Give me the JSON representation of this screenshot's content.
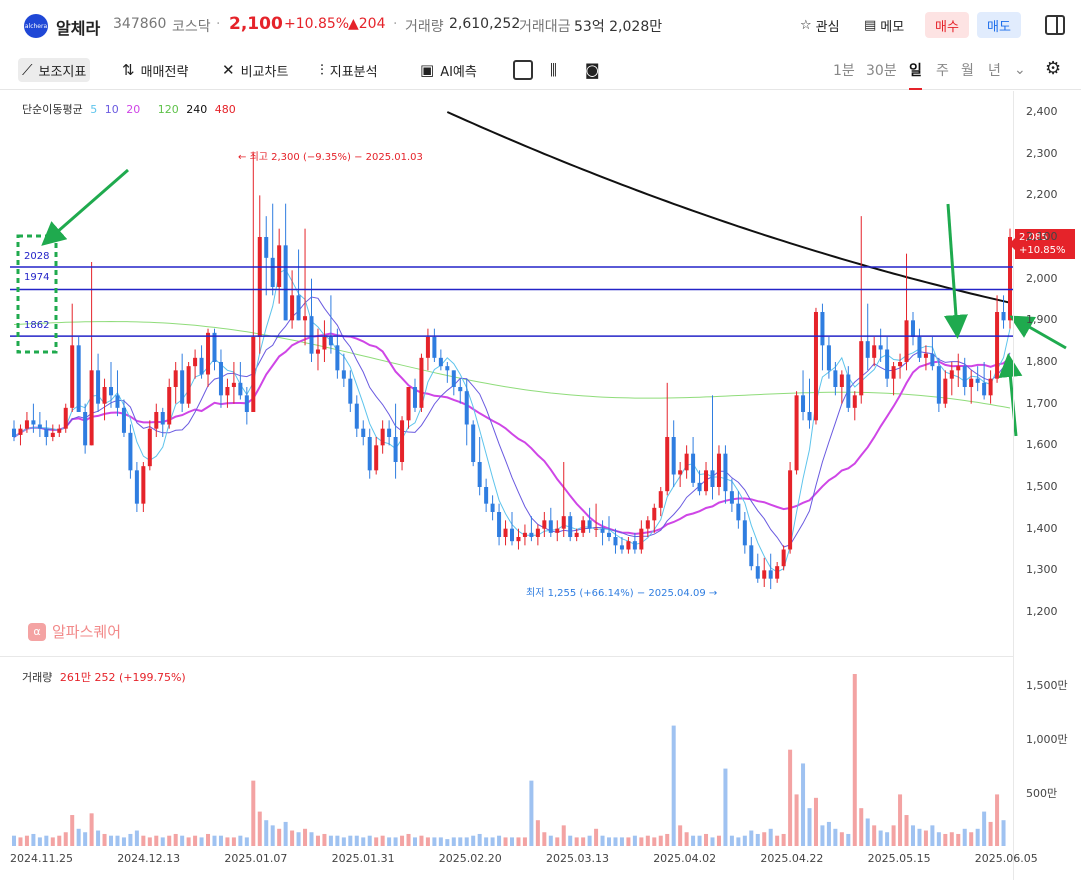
{
  "header": {
    "logo_text": "alchera",
    "name": "알체라",
    "code": "347860",
    "market": "코스닥",
    "separator": "·",
    "price": "2,100",
    "change_pct": "+10.85%",
    "change_amt": "▲204",
    "volume_label": "거래량",
    "volume_value": "2,610,252",
    "amount_label": "거래대금",
    "amount_value": "53억 2,028만",
    "fav_label": "관심",
    "memo_label": "메모",
    "buy_label": "매수",
    "sell_label": "매도"
  },
  "toolbar": {
    "indicators_label": "보조지표",
    "strategy_label": "매매전략",
    "compare_label": "비교차트",
    "analysis_label": "지표분석",
    "ai_label": "AI예측",
    "periods": [
      "1분",
      "30분",
      "일",
      "주",
      "월",
      "년"
    ],
    "selected_period": "일"
  },
  "chart": {
    "ma_legend": {
      "label": "단순이동평균",
      "p5": "5",
      "p10": "10",
      "p20": "20",
      "p120": "120",
      "p240": "240",
      "p480": "480"
    },
    "colors": {
      "up": "#e5232a",
      "down": "#2f7de0",
      "ma5": "#5ec4ec",
      "ma10": "#6a5ae0",
      "ma20": "#cf46e6",
      "ma120": "#8fdc7a",
      "ma240": "#111111",
      "level": "#2424c8",
      "arrow": "#1faa4e"
    },
    "high_note": "최고 2,300 (−9.35%) − 2025.01.03",
    "low_note": "최저 1,255 (+66.14%) − 2025.04.09",
    "level_labels": [
      "2028",
      "1974",
      "1862"
    ],
    "levels": [
      2028,
      1974,
      1862
    ],
    "last_price": "2,085",
    "last_pct": "+10.85%",
    "watermark": "알파스퀘어",
    "watermark_icon": "α"
  },
  "volume": {
    "label": "거래량",
    "value": "261만 252 (+199.75%)"
  },
  "chart_data": {
    "type": "candlestick",
    "price_axis": {
      "ticks": [
        "2,400",
        "2,300",
        "2,200",
        "2,100",
        "2,000",
        "1,900",
        "1,800",
        "1,700",
        "1,600",
        "1,500",
        "1,400",
        "1,300",
        "1,200"
      ],
      "range": [
        1200,
        2400
      ]
    },
    "volume_axis": {
      "ticks": [
        "1,500만",
        "1,000만",
        "500만"
      ]
    },
    "x_ticks": [
      "2024.11.25",
      "2024.12.13",
      "2025.01.07",
      "2025.01.31",
      "2025.02.20",
      "2025.03.13",
      "2025.04.02",
      "2025.04.22",
      "2025.05.15",
      "2025.06.05"
    ],
    "candles": [
      [
        1640,
        1660,
        1610,
        1620
      ],
      [
        1625,
        1650,
        1600,
        1640
      ],
      [
        1640,
        1680,
        1630,
        1660
      ],
      [
        1660,
        1700,
        1630,
        1650
      ],
      [
        1650,
        1680,
        1620,
        1640
      ],
      [
        1640,
        1660,
        1600,
        1620
      ],
      [
        1620,
        1650,
        1610,
        1630
      ],
      [
        1630,
        1650,
        1620,
        1640
      ],
      [
        1640,
        1700,
        1630,
        1690
      ],
      [
        1690,
        1940,
        1680,
        1840
      ],
      [
        1840,
        1860,
        1700,
        1680
      ],
      [
        1680,
        1700,
        1580,
        1600
      ],
      [
        1600,
        2040,
        1600,
        1780
      ],
      [
        1780,
        1820,
        1680,
        1700
      ],
      [
        1700,
        1760,
        1660,
        1740
      ],
      [
        1740,
        1800,
        1690,
        1720
      ],
      [
        1720,
        1780,
        1670,
        1690
      ],
      [
        1690,
        1710,
        1620,
        1630
      ],
      [
        1630,
        1650,
        1520,
        1540
      ],
      [
        1540,
        1560,
        1440,
        1460
      ],
      [
        1460,
        1560,
        1440,
        1550
      ],
      [
        1550,
        1660,
        1540,
        1640
      ],
      [
        1640,
        1700,
        1620,
        1680
      ],
      [
        1680,
        1690,
        1620,
        1650
      ],
      [
        1650,
        1760,
        1640,
        1740
      ],
      [
        1740,
        1800,
        1700,
        1780
      ],
      [
        1780,
        1820,
        1680,
        1700
      ],
      [
        1700,
        1800,
        1690,
        1790
      ],
      [
        1790,
        1830,
        1760,
        1810
      ],
      [
        1810,
        1840,
        1760,
        1770
      ],
      [
        1770,
        1880,
        1740,
        1870
      ],
      [
        1870,
        1880,
        1780,
        1800
      ],
      [
        1800,
        1830,
        1690,
        1720
      ],
      [
        1720,
        1760,
        1690,
        1740
      ],
      [
        1740,
        1800,
        1700,
        1750
      ],
      [
        1750,
        1800,
        1710,
        1720
      ],
      [
        1720,
        1740,
        1650,
        1680
      ],
      [
        1680,
        2300,
        1690,
        1860
      ],
      [
        1860,
        2200,
        1820,
        2100
      ],
      [
        2100,
        2150,
        1960,
        2050
      ],
      [
        2050,
        2180,
        1960,
        1980
      ],
      [
        1980,
        2120,
        1940,
        2080
      ],
      [
        2080,
        2180,
        1900,
        1900
      ],
      [
        1900,
        2020,
        1880,
        1960
      ],
      [
        1960,
        2070,
        1900,
        1900
      ],
      [
        1900,
        2120,
        1840,
        1910
      ],
      [
        1910,
        2000,
        1800,
        1820
      ],
      [
        1820,
        1880,
        1780,
        1830
      ],
      [
        1830,
        1900,
        1800,
        1860
      ],
      [
        1860,
        1960,
        1820,
        1840
      ],
      [
        1840,
        1880,
        1760,
        1780
      ],
      [
        1780,
        1820,
        1740,
        1760
      ],
      [
        1760,
        1780,
        1680,
        1700
      ],
      [
        1700,
        1720,
        1620,
        1640
      ],
      [
        1640,
        1660,
        1600,
        1620
      ],
      [
        1620,
        1640,
        1520,
        1540
      ],
      [
        1540,
        1620,
        1530,
        1600
      ],
      [
        1600,
        1660,
        1580,
        1640
      ],
      [
        1640,
        1660,
        1600,
        1620
      ],
      [
        1620,
        1700,
        1520,
        1560
      ],
      [
        1560,
        1670,
        1540,
        1660
      ],
      [
        1660,
        1740,
        1640,
        1740
      ],
      [
        1740,
        1760,
        1680,
        1690
      ],
      [
        1690,
        1820,
        1680,
        1810
      ],
      [
        1810,
        1880,
        1780,
        1860
      ],
      [
        1860,
        1880,
        1800,
        1810
      ],
      [
        1810,
        1830,
        1780,
        1790
      ],
      [
        1790,
        1800,
        1750,
        1780
      ],
      [
        1780,
        1780,
        1720,
        1740
      ],
      [
        1740,
        1760,
        1700,
        1730
      ],
      [
        1730,
        1760,
        1600,
        1650
      ],
      [
        1650,
        1660,
        1550,
        1560
      ],
      [
        1560,
        1620,
        1480,
        1500
      ],
      [
        1500,
        1520,
        1440,
        1460
      ],
      [
        1460,
        1480,
        1420,
        1440
      ],
      [
        1440,
        1460,
        1360,
        1380
      ],
      [
        1380,
        1420,
        1360,
        1400
      ],
      [
        1400,
        1440,
        1360,
        1370
      ],
      [
        1370,
        1400,
        1350,
        1380
      ],
      [
        1380,
        1410,
        1360,
        1390
      ],
      [
        1390,
        1430,
        1370,
        1380
      ],
      [
        1380,
        1410,
        1360,
        1400
      ],
      [
        1400,
        1440,
        1380,
        1420
      ],
      [
        1420,
        1450,
        1380,
        1390
      ],
      [
        1390,
        1420,
        1370,
        1400
      ],
      [
        1400,
        1560,
        1380,
        1430
      ],
      [
        1430,
        1440,
        1370,
        1380
      ],
      [
        1380,
        1400,
        1370,
        1390
      ],
      [
        1390,
        1430,
        1380,
        1420
      ],
      [
        1420,
        1450,
        1390,
        1400
      ],
      [
        1400,
        1460,
        1380,
        1400
      ],
      [
        1400,
        1420,
        1360,
        1390
      ],
      [
        1390,
        1430,
        1370,
        1380
      ],
      [
        1380,
        1400,
        1340,
        1360
      ],
      [
        1360,
        1380,
        1340,
        1350
      ],
      [
        1350,
        1380,
        1340,
        1370
      ],
      [
        1370,
        1390,
        1340,
        1350
      ],
      [
        1350,
        1420,
        1340,
        1400
      ],
      [
        1400,
        1430,
        1380,
        1420
      ],
      [
        1420,
        1460,
        1390,
        1450
      ],
      [
        1450,
        1500,
        1430,
        1490
      ],
      [
        1490,
        1750,
        1480,
        1620
      ],
      [
        1620,
        1660,
        1500,
        1530
      ],
      [
        1530,
        1560,
        1500,
        1540
      ],
      [
        1540,
        1600,
        1520,
        1580
      ],
      [
        1580,
        1620,
        1500,
        1510
      ],
      [
        1510,
        1540,
        1480,
        1490
      ],
      [
        1490,
        1560,
        1480,
        1540
      ],
      [
        1540,
        1720,
        1470,
        1500
      ],
      [
        1500,
        1600,
        1480,
        1580
      ],
      [
        1580,
        1600,
        1460,
        1490
      ],
      [
        1490,
        1520,
        1440,
        1460
      ],
      [
        1460,
        1490,
        1400,
        1420
      ],
      [
        1420,
        1440,
        1340,
        1360
      ],
      [
        1360,
        1380,
        1300,
        1310
      ],
      [
        1310,
        1340,
        1270,
        1280
      ],
      [
        1280,
        1330,
        1260,
        1300
      ],
      [
        1300,
        1340,
        1255,
        1280
      ],
      [
        1280,
        1320,
        1270,
        1310
      ],
      [
        1310,
        1360,
        1300,
        1350
      ],
      [
        1350,
        1560,
        1340,
        1540
      ],
      [
        1540,
        1730,
        1530,
        1720
      ],
      [
        1720,
        1780,
        1660,
        1680
      ],
      [
        1680,
        1760,
        1640,
        1660
      ],
      [
        1660,
        1930,
        1650,
        1920
      ],
      [
        1920,
        1940,
        1780,
        1840
      ],
      [
        1840,
        1860,
        1760,
        1780
      ],
      [
        1780,
        1800,
        1720,
        1740
      ],
      [
        1740,
        1780,
        1700,
        1770
      ],
      [
        1770,
        1790,
        1680,
        1690
      ],
      [
        1690,
        1730,
        1660,
        1720
      ],
      [
        1720,
        2150,
        1700,
        1850
      ],
      [
        1850,
        1940,
        1780,
        1810
      ],
      [
        1810,
        1860,
        1790,
        1840
      ],
      [
        1840,
        1880,
        1800,
        1830
      ],
      [
        1830,
        1860,
        1740,
        1760
      ],
      [
        1760,
        1800,
        1720,
        1790
      ],
      [
        1790,
        1820,
        1760,
        1800
      ],
      [
        1800,
        2060,
        1780,
        1900
      ],
      [
        1900,
        1920,
        1840,
        1860
      ],
      [
        1860,
        1880,
        1800,
        1810
      ],
      [
        1810,
        1840,
        1780,
        1820
      ],
      [
        1820,
        1860,
        1780,
        1790
      ],
      [
        1790,
        1810,
        1680,
        1700
      ],
      [
        1700,
        1780,
        1690,
        1760
      ],
      [
        1760,
        1800,
        1720,
        1780
      ],
      [
        1780,
        1820,
        1740,
        1790
      ],
      [
        1790,
        1810,
        1720,
        1740
      ],
      [
        1740,
        1780,
        1700,
        1760
      ],
      [
        1760,
        1790,
        1730,
        1750
      ],
      [
        1750,
        1800,
        1710,
        1720
      ],
      [
        1720,
        1780,
        1700,
        1760
      ],
      [
        1760,
        1960,
        1750,
        1920
      ],
      [
        1920,
        1960,
        1880,
        1900
      ],
      [
        1900,
        2120,
        1880,
        2100
      ]
    ],
    "volume_bars_relative": [
      6,
      5,
      6,
      7,
      5,
      6,
      5,
      6,
      8,
      18,
      10,
      8,
      19,
      9,
      7,
      6,
      6,
      5,
      7,
      9,
      6,
      5,
      6,
      5,
      6,
      7,
      6,
      5,
      6,
      5,
      7,
      6,
      6,
      5,
      5,
      6,
      5,
      38,
      20,
      15,
      12,
      10,
      14,
      9,
      8,
      10,
      8,
      6,
      7,
      6,
      6,
      5,
      6,
      6,
      5,
      6,
      5,
      6,
      5,
      5,
      6,
      7,
      5,
      6,
      5,
      5,
      5,
      4,
      5,
      5,
      5,
      6,
      7,
      5,
      5,
      6,
      5,
      5,
      5,
      5,
      38,
      15,
      8,
      6,
      5,
      12,
      6,
      5,
      5,
      6,
      10,
      6,
      5,
      5,
      5,
      5,
      6,
      5,
      6,
      5,
      6,
      7,
      70,
      12,
      8,
      6,
      6,
      7,
      5,
      6,
      45,
      6,
      5,
      6,
      9,
      7,
      8,
      10,
      6,
      7,
      56,
      30,
      48,
      22,
      28,
      12,
      14,
      10,
      8,
      7,
      100,
      22,
      16,
      12,
      9,
      8,
      12,
      30,
      18,
      12,
      10,
      9,
      12,
      8,
      7,
      8,
      7,
      10,
      8,
      10,
      20,
      14,
      30,
      15
    ]
  }
}
